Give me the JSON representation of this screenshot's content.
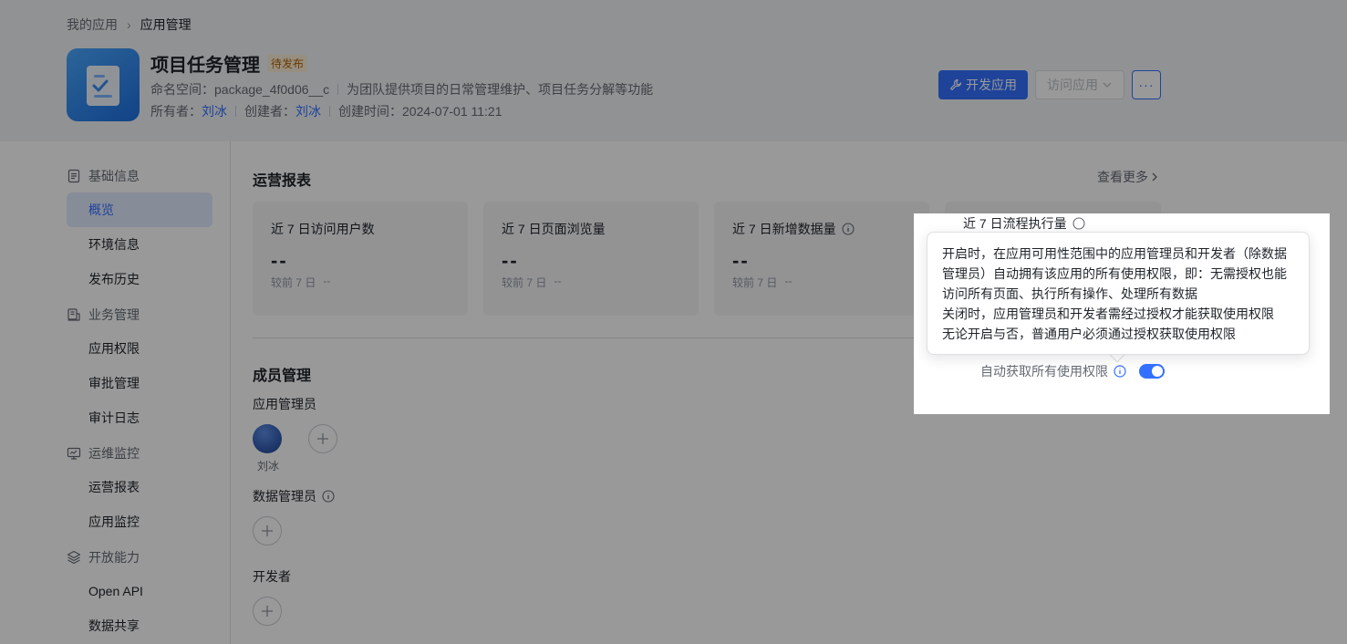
{
  "breadcrumb": {
    "parent": "我的应用",
    "separator": "›",
    "current": "应用管理"
  },
  "app": {
    "title": "项目任务管理",
    "status": "待发布",
    "namespace_label": "命名空间：",
    "namespace": "package_4f0d06__c",
    "description": "为团队提供项目的日常管理维护、项目任务分解等功能",
    "owner_label": "所有者：",
    "owner": "刘冰",
    "creator_label": "创建者：",
    "creator": "刘冰",
    "created_label": "创建时间：",
    "created": "2024-07-01 11:21"
  },
  "actions": {
    "develop": "开发应用",
    "visit": "访问应用",
    "more": "···"
  },
  "sidebar": {
    "groups": [
      {
        "label": "基础信息",
        "icon": "doc-icon",
        "items": [
          "概览",
          "环境信息",
          "发布历史"
        ]
      },
      {
        "label": "业务管理",
        "icon": "briefcase-icon",
        "items": [
          "应用权限",
          "审批管理",
          "审计日志"
        ]
      },
      {
        "label": "运维监控",
        "icon": "monitor-icon",
        "items": [
          "运营报表",
          "应用监控"
        ]
      },
      {
        "label": "开放能力",
        "icon": "layers-icon",
        "items": [
          "Open API",
          "数据共享"
        ]
      }
    ],
    "active": "概览"
  },
  "report": {
    "title": "运营报表",
    "see_more": "查看更多",
    "cards": [
      {
        "label": "近 7 日访问用户数",
        "value": "--",
        "compare_label": "较前 7 日",
        "compare_value": "--"
      },
      {
        "label": "近 7 日页面浏览量",
        "value": "--",
        "compare_label": "较前 7 日",
        "compare_value": "--"
      },
      {
        "label": "近 7 日新增数据量",
        "value": "--",
        "compare_label": "较前 7 日",
        "compare_value": "--"
      },
      {
        "label": "近 7 日流程执行量"
      }
    ]
  },
  "members": {
    "title": "成员管理",
    "admins_label": "应用管理员",
    "admin_name": "刘冰",
    "data_admins_label": "数据管理员",
    "developers_label": "开发者"
  },
  "tooltip": {
    "lines": [
      "开启时，在应用可用性范围中的应用管理员和开发者（除数据",
      "管理员）自动拥有该应用的所有使用权限，即：无需授权也能",
      "访问所有页面、执行所有操作、处理所有数据",
      "关闭时，应用管理员和开发者需经过授权才能获取使用权限",
      "无论开启与否，普通用户必须通过授权获取使用权限"
    ]
  },
  "permission": {
    "label": "自动获取所有使用权限",
    "enabled": true
  },
  "colors": {
    "primary": "#3370ff",
    "status_bg": "#fbeed7",
    "status_fg": "#b35f00"
  }
}
